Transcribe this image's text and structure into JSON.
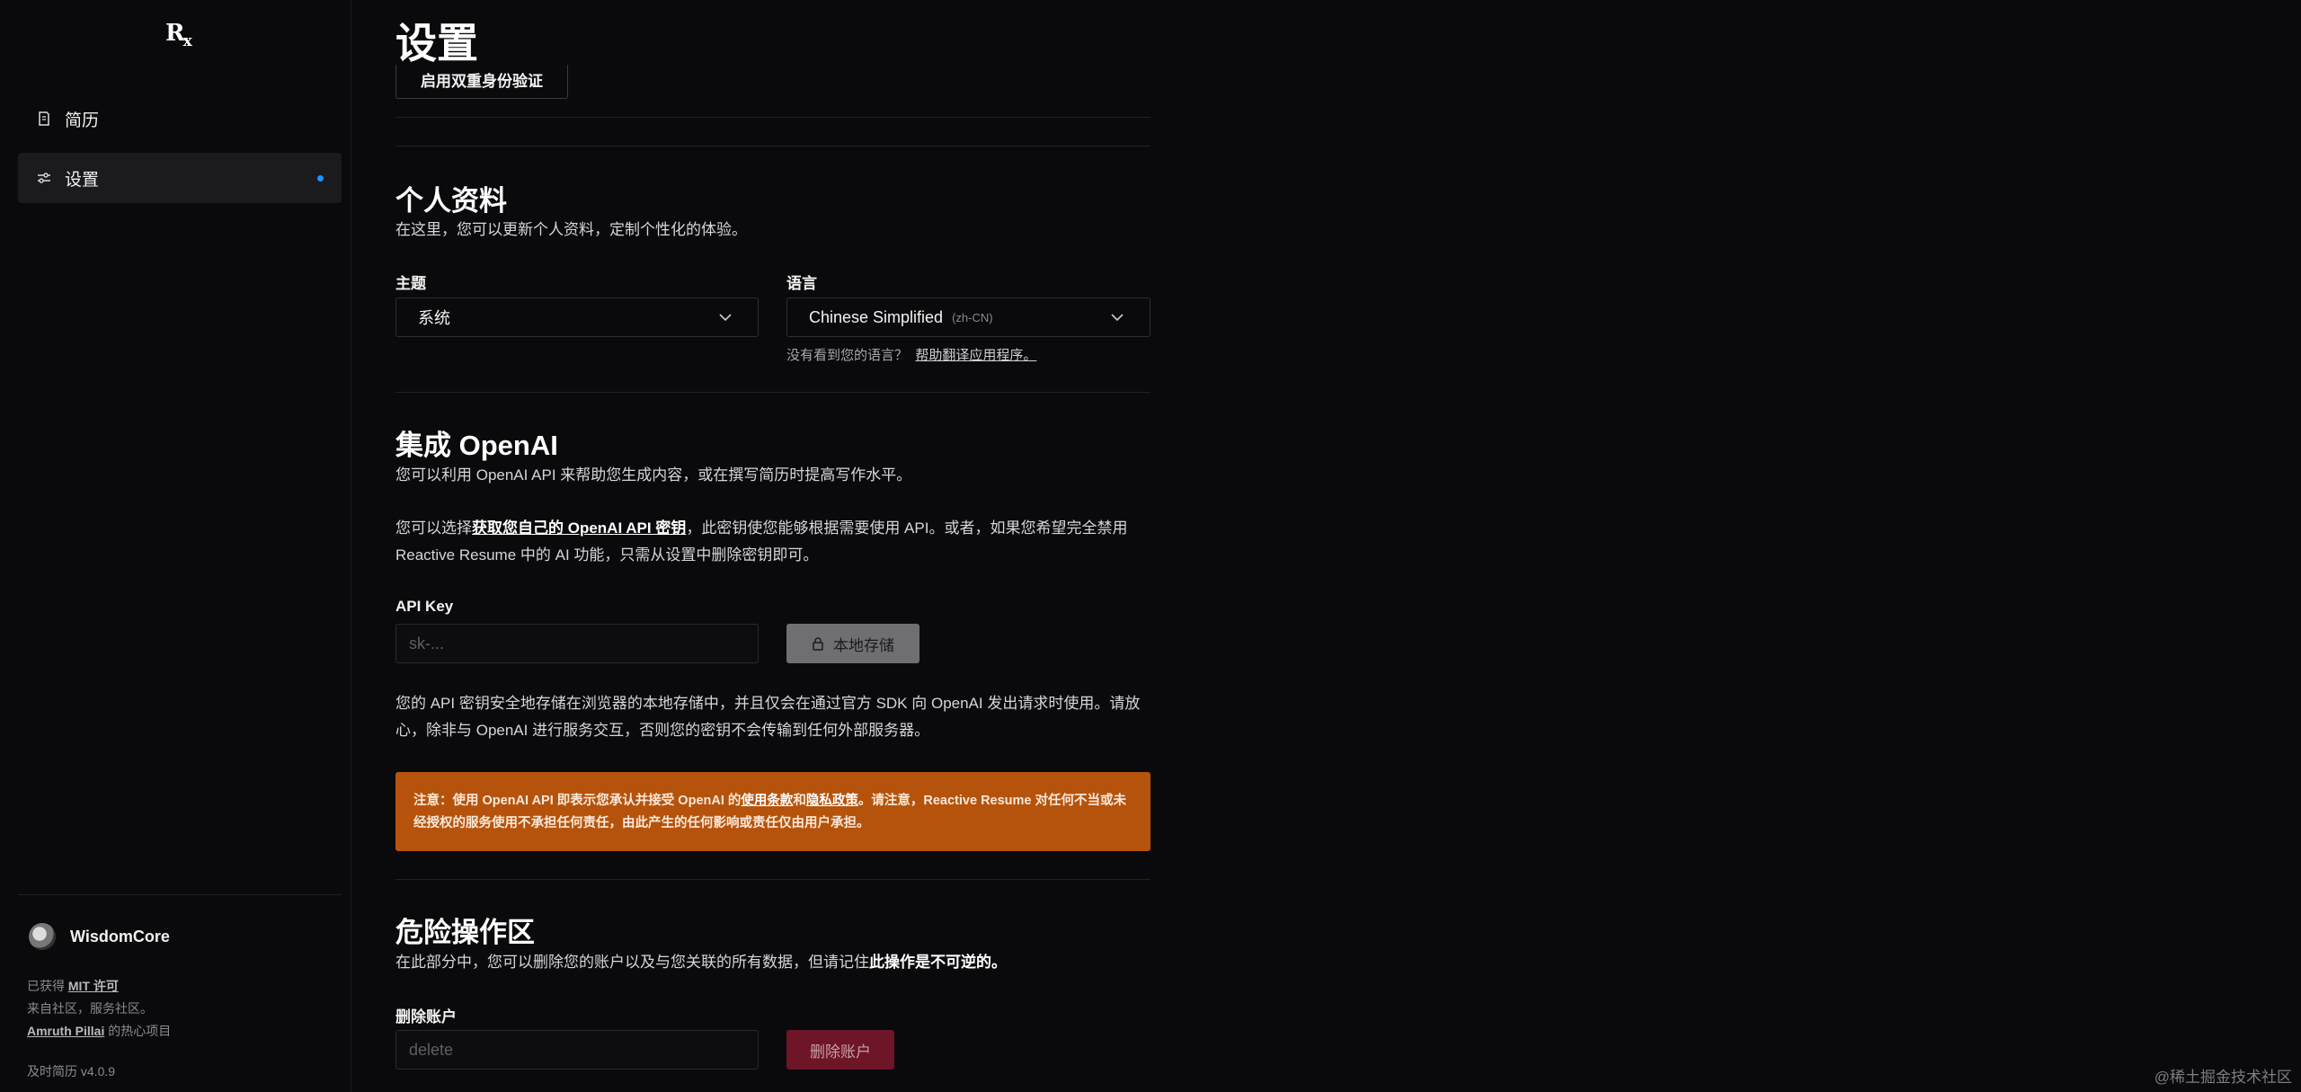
{
  "app": {
    "logo_main": "R",
    "logo_sub": "x"
  },
  "sidebar": {
    "items": [
      {
        "label": "简历",
        "icon": "document-icon"
      },
      {
        "label": "设置",
        "icon": "sliders-icon"
      }
    ],
    "user": {
      "name": "WisdomCore"
    },
    "footer": {
      "license_prefix": "已获得 ",
      "license_link": "MIT 许可",
      "community": "来自社区，服务社区。",
      "author_link": "Amruth Pillai",
      "author_suffix": " 的热心项目",
      "version": "及时简历 v4.0.9"
    }
  },
  "page": {
    "title": "设置",
    "two_factor_button": "启用双重身份验证"
  },
  "profile": {
    "heading": "个人资料",
    "description": "在这里，您可以更新个人资料，定制个性化的体验。",
    "theme_label": "主题",
    "theme_value": "系统",
    "language_label": "语言",
    "language_value": "Chinese Simplified",
    "language_code": "(zh-CN)",
    "language_hint": "没有看到您的语言？",
    "language_hint_link": "帮助翻译应用程序。"
  },
  "openai": {
    "heading": "集成 OpenAI",
    "description": "您可以利用 OpenAI API 来帮助您生成内容，或在撰写简历时提高写作水平。",
    "para_prefix": "您可以选择",
    "para_link": "获取您自己的 OpenAI API 密钥",
    "para_suffix": "，此密钥使您能够根据需要使用 API。或者，如果您希望完全禁用 Reactive Resume 中的 AI 功能，只需从设置中删除密钥即可。",
    "api_key_label": "API Key",
    "api_key_placeholder": "sk-...",
    "store_button": "本地存储",
    "storage_note": "您的 API 密钥安全地存储在浏览器的本地存储中，并且仅会在通过官方 SDK 向 OpenAI 发出请求时使用。请放心，除非与 OpenAI 进行服务交互，否则您的密钥不会传输到任何外部服务器。",
    "notice_prefix": "注意：使用 OpenAI API 即表示您承认并接受 OpenAI 的",
    "notice_terms": "使用条款",
    "notice_and": "和",
    "notice_privacy": "隐私政策",
    "notice_suffix": "。请注意，Reactive Resume 对任何不当或未经授权的服务使用不承担任何责任，由此产生的任何影响或责任仅由用户承担。"
  },
  "danger": {
    "heading": "危险操作区",
    "description_prefix": "在此部分中，您可以删除您的账户以及与您关联的所有数据，但请记住",
    "description_bold": "此操作是不可逆的。",
    "delete_label": "删除账户",
    "delete_placeholder": "delete",
    "delete_button": "删除账户"
  },
  "watermark": "@稀土掘金技术社区",
  "colors": {
    "background": "#0a0a0c",
    "active_dot": "#1e90ff",
    "notice": "#b5530c",
    "danger_button": "#6e1528"
  }
}
